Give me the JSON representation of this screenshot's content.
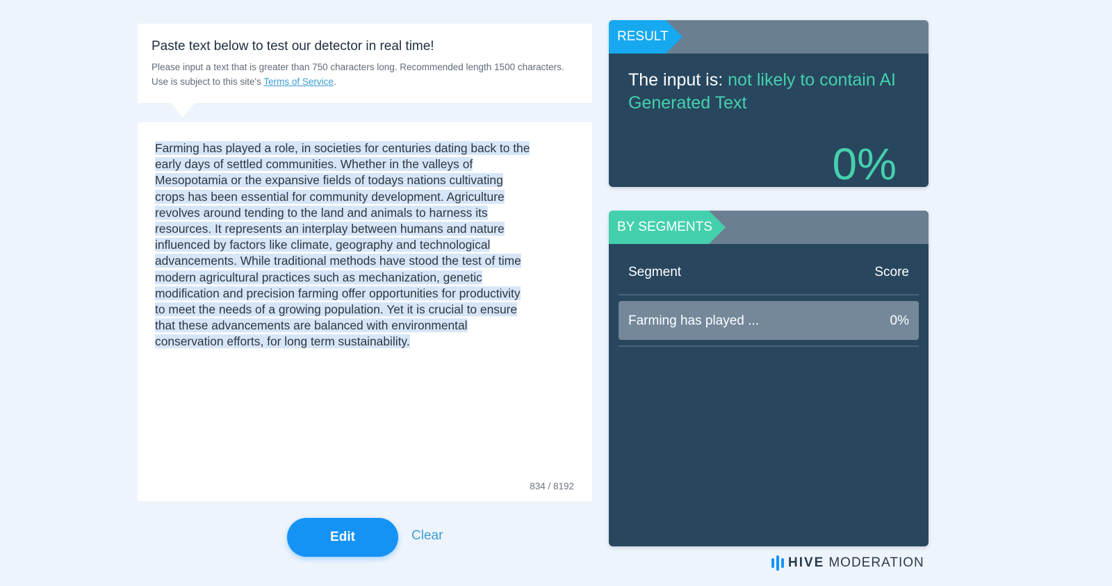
{
  "instructions": {
    "title": "Paste text below to test our detector in real time!",
    "text": "Please input a text that is greater than 750 characters long. Recommended length 1500 characters. Use is subject to this site's ",
    "link": "Terms of Service",
    "after_link": "."
  },
  "input": {
    "lines": [
      "Farming has played a role, in societies for centuries dating back to the",
      "early days of settled communities. Whether in the valleys of",
      "Mesopotamia or the expansive fields of todays nations cultivating",
      "crops has been essential for community development. Agriculture",
      "revolves around tending to the land and animals to harness its",
      "resources. It represents an interplay between humans and nature",
      "influenced by factors like climate, geography and technological",
      "advancements. While traditional methods have stood the test of time",
      "modern agricultural practices such as mechanization, genetic",
      "modification and precision farming offer opportunities for productivity",
      "to meet the needs of a growing population. Yet it is crucial to ensure",
      "that these advancements are balanced with environmental",
      "conservation efforts, for long term sustainability."
    ],
    "counter": "834 / 8192"
  },
  "actions": {
    "edit_label": "Edit",
    "clear_label": "Clear"
  },
  "result": {
    "tag": "RESULT",
    "prefix": "The input is: ",
    "verdict": "not likely to contain AI Generated Text",
    "percent": "0%"
  },
  "segments": {
    "tag": "BY SEGMENTS",
    "col_segment": "Segment",
    "col_score": "Score",
    "rows": [
      {
        "text": "Farming has played ...",
        "score": "0%"
      }
    ]
  },
  "logo": {
    "brand": "HIVE",
    "sub": "MODERATION"
  },
  "colors": {
    "accent_blue": "#1593f5",
    "accent_green": "#45d0ad",
    "panel_bg": "#28475f"
  }
}
